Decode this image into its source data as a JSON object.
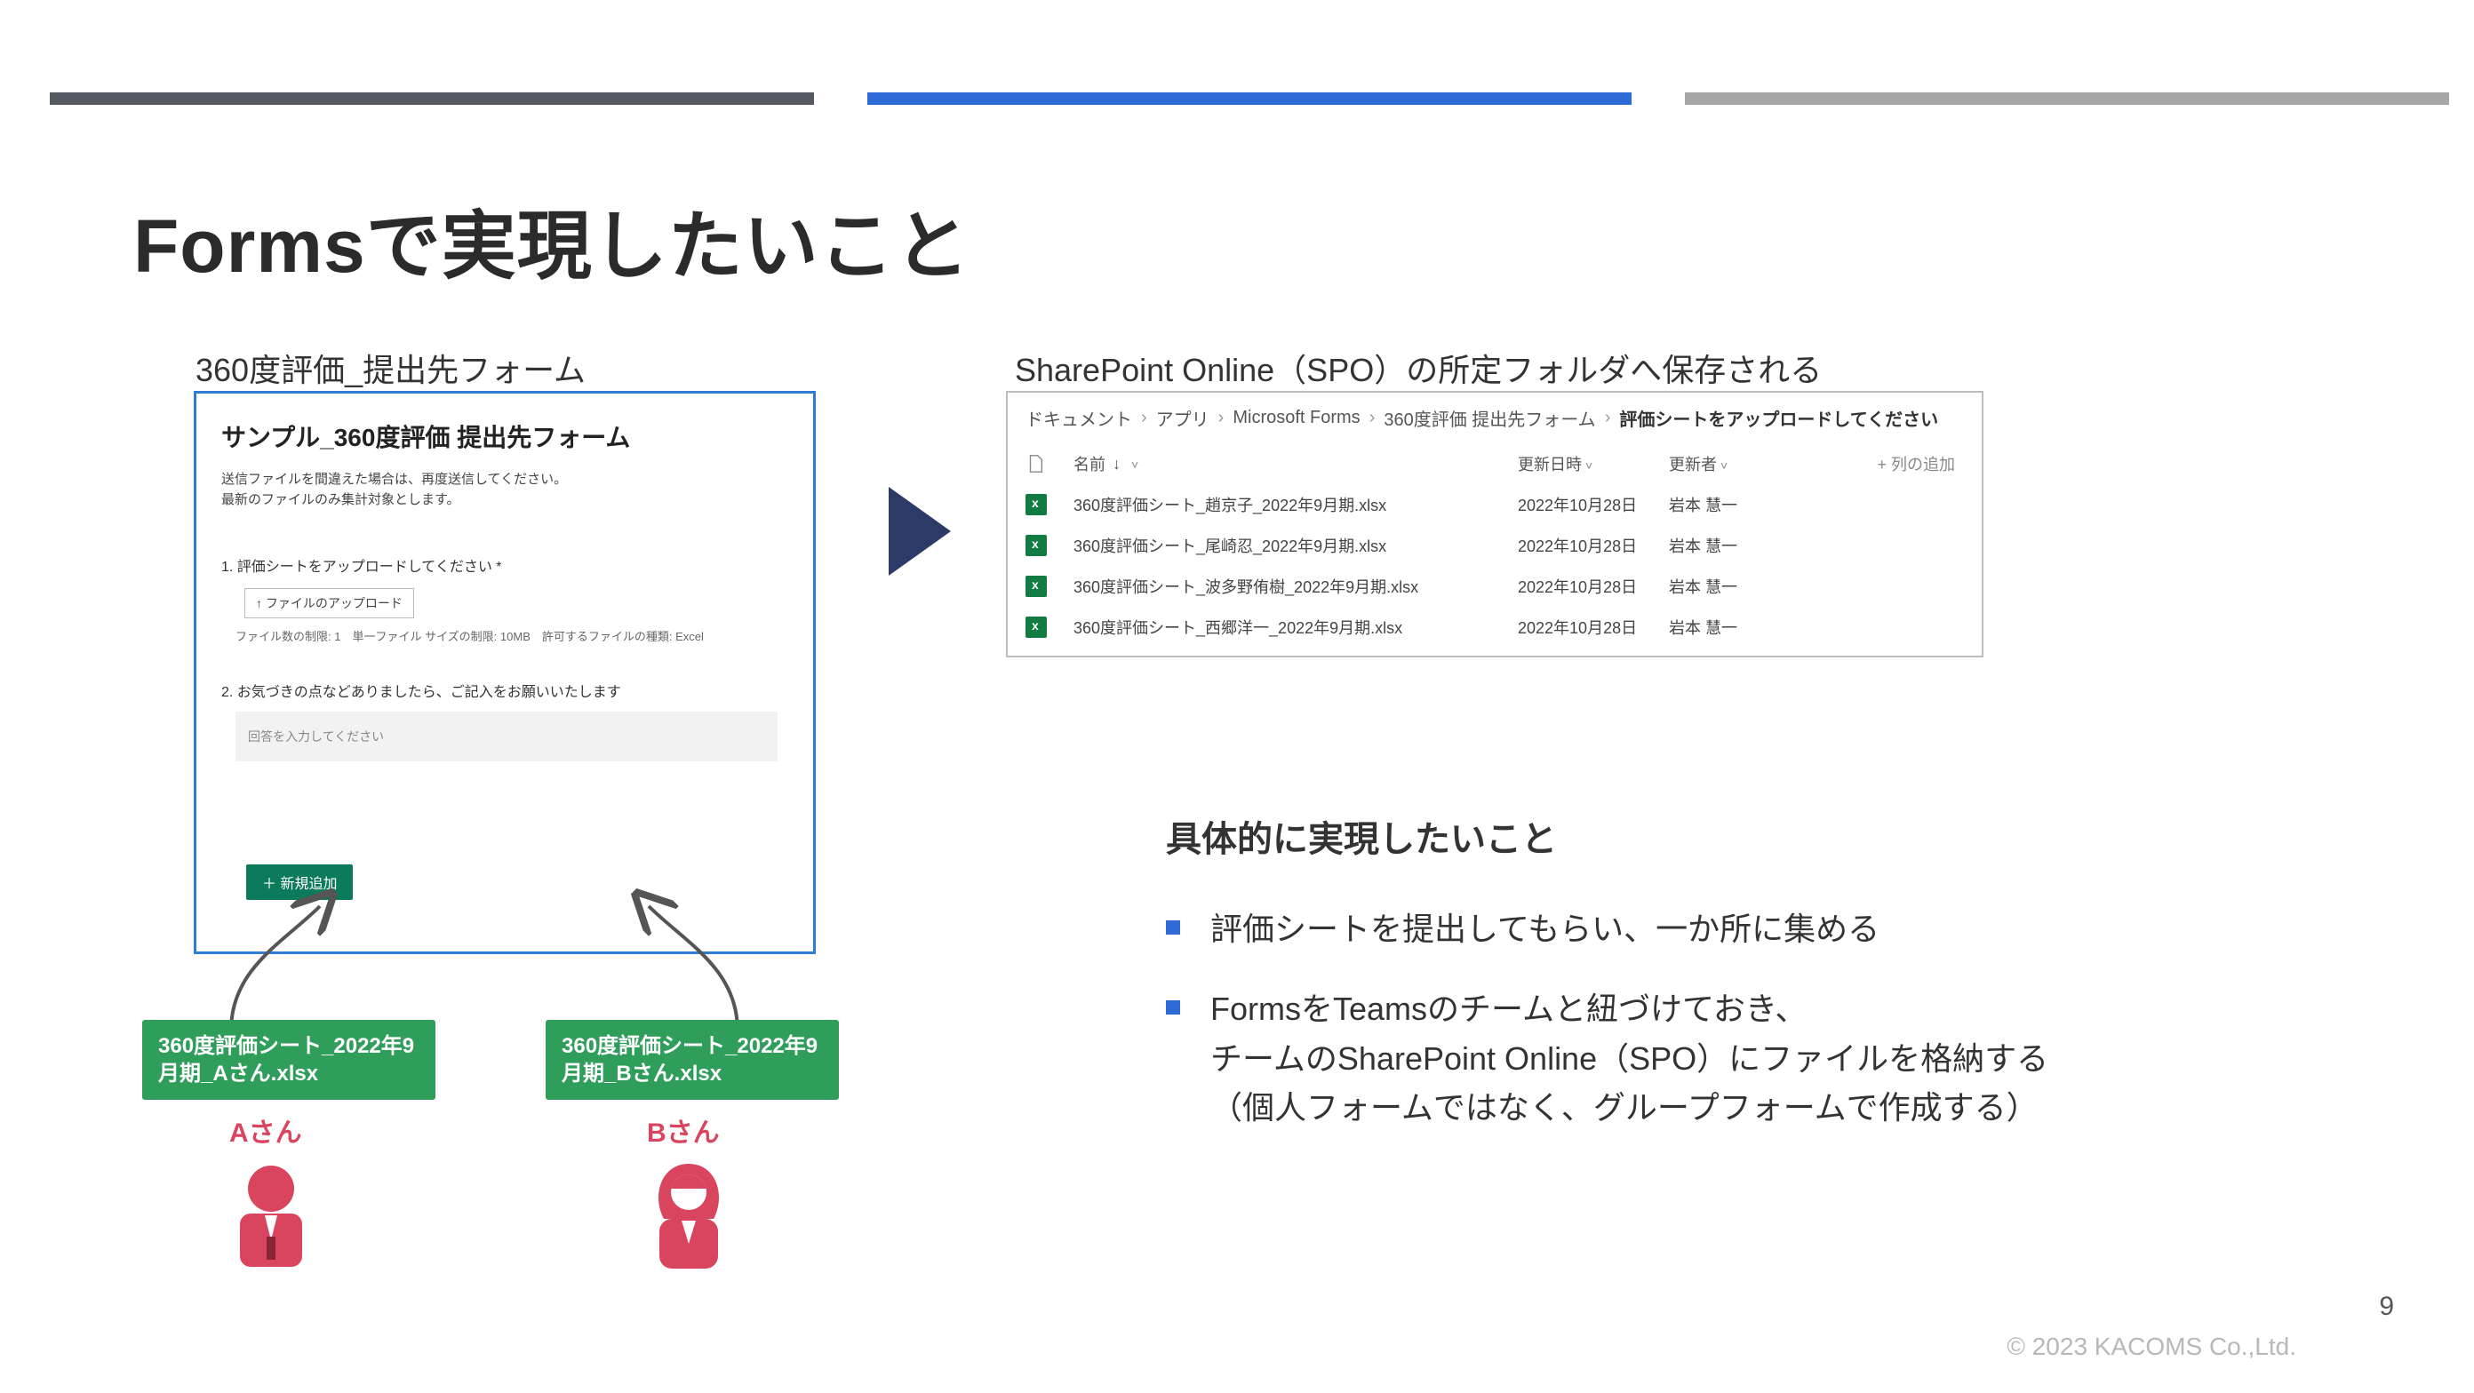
{
  "title": "Formsで実現したいこと",
  "left_caption": "360度評価_提出先フォーム",
  "right_caption": "SharePoint Online（SPO）の所定フォルダへ保存される",
  "forms": {
    "title": "サンプル_360度評価 提出先フォーム",
    "sub1": "送信ファイルを間違えた場合は、再度送信してください。",
    "sub2": "最新のファイルのみ集計対象とします。",
    "q1": "1. 評価シートをアップロードしてください *",
    "upload_btn": "↑ ファイルのアップロード",
    "hint": "ファイル数の制限: 1　単一ファイル サイズの制限: 10MB　許可するファイルの種類: Excel",
    "q2": "2. お気づきの点などありましたら、ご記入をお願いいたします",
    "placeholder": "回答を入力してください",
    "add_btn": "＋ 新規追加"
  },
  "spo": {
    "crumbs": [
      "ドキュメント",
      "アプリ",
      "Microsoft Forms",
      "360度評価 提出先フォーム",
      "評価シートをアップロードしてください"
    ],
    "headers": {
      "name": "名前",
      "sort": "↓",
      "updated": "更新日時",
      "updater": "更新者",
      "add_col": "+ 列の追加"
    },
    "rows": [
      {
        "name": "360度評価シート_趙京子_2022年9月期.xlsx",
        "updated": "2022年10月28日",
        "updater": "岩本 慧一"
      },
      {
        "name": "360度評価シート_尾崎忍_2022年9月期.xlsx",
        "updated": "2022年10月28日",
        "updater": "岩本 慧一"
      },
      {
        "name": "360度評価シート_波多野侑樹_2022年9月期.xlsx",
        "updated": "2022年10月28日",
        "updater": "岩本 慧一"
      },
      {
        "name": "360度評価シート_西郷洋一_2022年9月期.xlsx",
        "updated": "2022年10月28日",
        "updater": "岩本 慧一"
      }
    ]
  },
  "files": {
    "a": "360度評価シート_2022年9月期_Aさん.xlsx",
    "b": "360度評価シート_2022年9月期_Bさん.xlsx"
  },
  "people": {
    "a": "Aさん",
    "b": "Bさん"
  },
  "body_title": "具体的に実現したいこと",
  "bullets": [
    "評価シートを提出してもらい、一か所に集める",
    "FormsをTeamsのチームと紐づけておき、\nチームのSharePoint Online（SPO）にファイルを格納する\n（個人フォームではなく、グループフォームで作成する）"
  ],
  "footer": {
    "copyright": "© 2023 KACOMS Co.,Ltd.",
    "page": "9"
  }
}
